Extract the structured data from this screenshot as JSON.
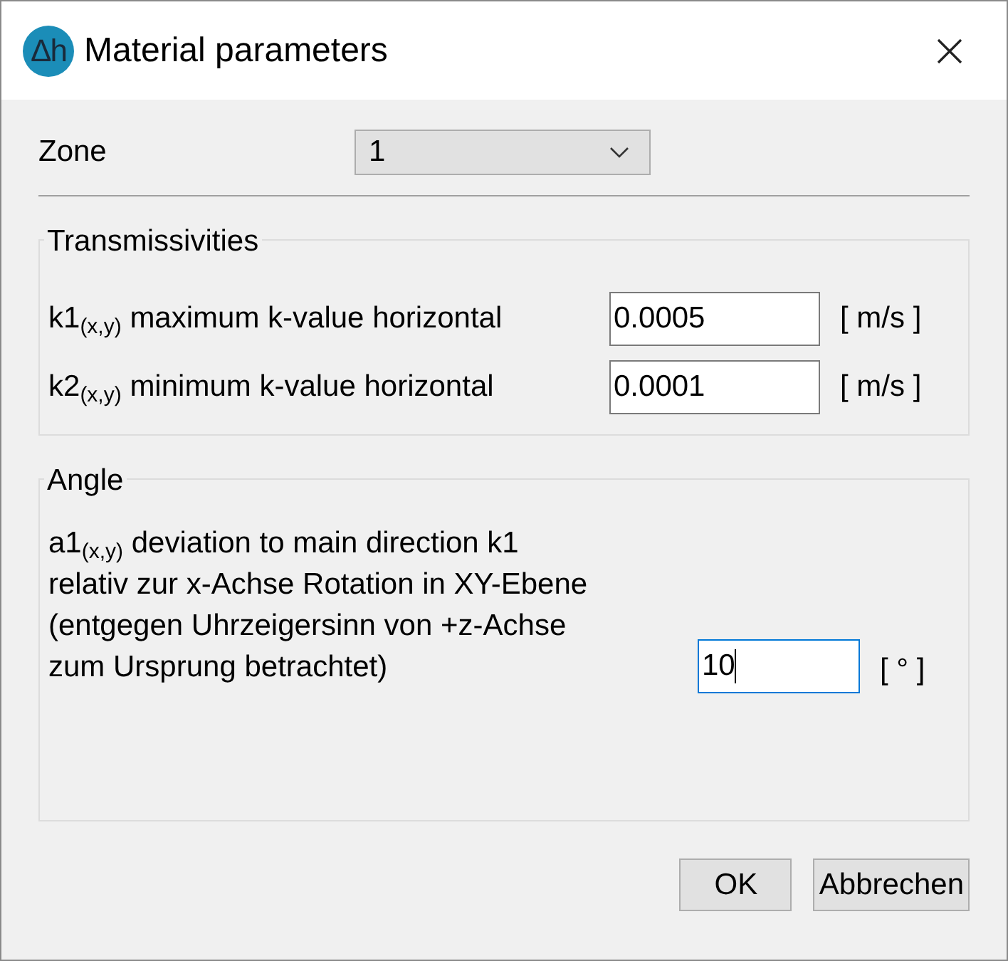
{
  "window": {
    "logo": "Δh",
    "title": "Material parameters"
  },
  "zone": {
    "label": "Zone",
    "value": "1"
  },
  "transmissivities": {
    "title": "Transmissivities",
    "rows": [
      {
        "label": "k1$_{(x,y)}$ maximum k-value horizontal",
        "value": "0.0005",
        "unit": "[ m/s ]",
        "focused": false
      },
      {
        "label": "k2$_{(x,y)}$ minimum k-value horizontal",
        "value": "0.0001",
        "unit": "[ m/s ]",
        "focused": false
      }
    ]
  },
  "angle": {
    "title": "Angle",
    "label_lines": [
      "a1$_{(x,y)}$ deviation to main direction k1",
      "relativ zur x-Achse Rotation in XY-Ebene",
      "(entgegen Uhrzeigersinn von +z-Achse",
      "zum Ursprung betrachtet)"
    ],
    "value": "10",
    "unit": "[ ° ]",
    "focused": true
  },
  "buttons": [
    "OK",
    "Abbrechen"
  ]
}
